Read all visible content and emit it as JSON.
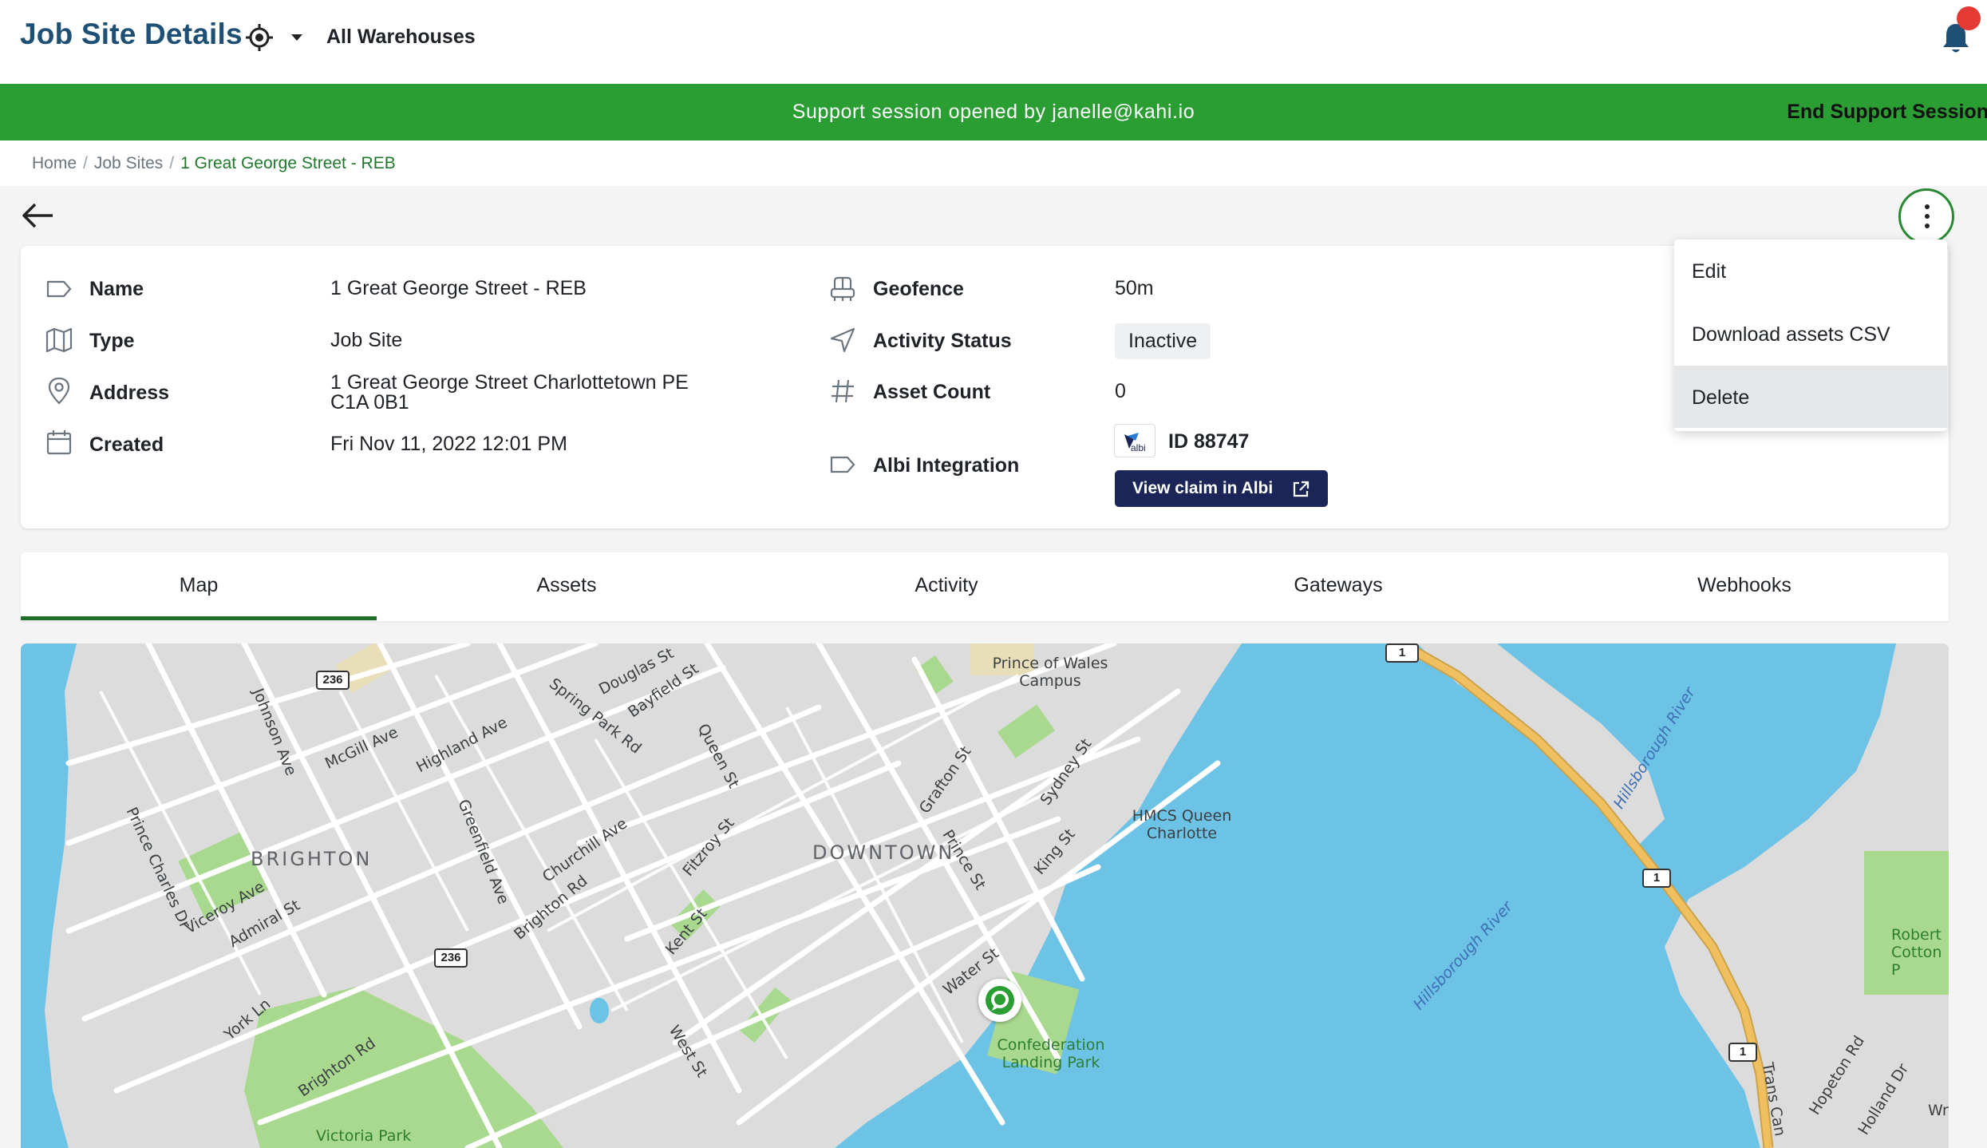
{
  "header": {
    "title": "Job Site Details",
    "warehouse_selector": "All Warehouses",
    "location_icon": "crosshair-location-icon",
    "notification_icon": "bell-icon"
  },
  "banner": {
    "message": "Support session opened by janelle@kahi.io",
    "end_label": "End Support Session",
    "color": "#2a9d33"
  },
  "breadcrumb": {
    "items": [
      "Home",
      "Job Sites"
    ],
    "current": "1 Great George Street - REB"
  },
  "details": {
    "name_label": "Name",
    "name_value": "1 Great George Street - REB",
    "type_label": "Type",
    "type_value": "Job Site",
    "address_label": "Address",
    "address_line1": "1 Great George Street Charlottetown PE",
    "address_line2": "C1A 0B1",
    "created_label": "Created",
    "created_value": "Fri Nov 11, 2022 12:01 PM",
    "geofence_label": "Geofence",
    "geofence_value": "50m",
    "activity_label": "Activity Status",
    "activity_value": "Inactive",
    "asset_count_label": "Asset Count",
    "asset_count_value": "0",
    "albi_label": "Albi Integration",
    "albi_id": "ID 88747",
    "albi_button": "View claim in Albi",
    "albi_logo_text": "albi"
  },
  "menu": {
    "items": [
      "Edit",
      "Download assets CSV",
      "Delete"
    ],
    "highlighted": "Delete"
  },
  "tabs": {
    "items": [
      "Map",
      "Assets",
      "Activity",
      "Gateways",
      "Webhooks"
    ],
    "active": "Map"
  },
  "map": {
    "districts": [
      "BRIGHTON",
      "DOWNTOWN"
    ],
    "streets": [
      "Johnson Ave",
      "McGill Ave",
      "Highland Ave",
      "Douglas St",
      "Bayfield St",
      "Spring Park Rd",
      "Queen St",
      "Prince Charles Dr",
      "Greenfield Ave",
      "Churchill Ave",
      "Fitzroy St",
      "Grafton St",
      "Prince St",
      "Sydney St",
      "King St",
      "Viceroy Ave",
      "Admiral St",
      "Brighton Rd",
      "Kent St",
      "Water St",
      "York Ln",
      "West St",
      "Hopeton Rd",
      "Holland Dr",
      "Trans Can",
      "Wr"
    ],
    "places": [
      "Prince of Wales Campus",
      "HMCS Queen Charlotte",
      "Confederation Landing Park",
      "Victoria Park",
      "Robert Cotton P"
    ],
    "water": [
      "Hillsborough River"
    ],
    "route_shields": [
      "236",
      "1"
    ],
    "colors": {
      "water": "#6cc3e6",
      "land": "#dcdcdc",
      "park": "#a8d98f",
      "road": "#ffffff",
      "highway": "#f0c060"
    }
  }
}
